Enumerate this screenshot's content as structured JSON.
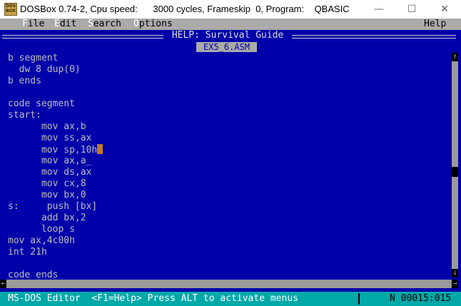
{
  "window": {
    "title": "DOSBox 0.74-2, Cpu speed:      3000 cycles, Frameskip  0, Program:    QBASIC",
    "icon_text": "DOS BOX",
    "minimize": "—",
    "maximize": "☐",
    "close": "✕"
  },
  "menu": {
    "file_hot": "F",
    "file_rest": "ile",
    "edit_hot": "E",
    "edit_rest": "dit",
    "search_hot": "S",
    "search_rest": "earch",
    "options_hot": "O",
    "options_rest": "ptions",
    "help": "Help"
  },
  "help_title": " HELP: Survival Guide ",
  "tab_label": "EX5_6.ASM",
  "code_lines": [
    "b segment",
    "  dw 8 dup(0)",
    "b ends",
    "",
    "code segment",
    "start:",
    "      mov ax,b",
    "      mov ss,ax",
    "      mov sp,10h",
    "      mov ax,a_",
    "      mov ds,ax",
    "      mov cx,8",
    "      mov bx,0",
    "s:     push [bx]",
    "      add bx,2",
    "      loop s",
    "mov ax,4c00h",
    "int 21h",
    "",
    "code ends"
  ],
  "scroll": {
    "up": "↑",
    "down": "↓",
    "left": "←",
    "right": "→"
  },
  "status": {
    "left": "MS-DOS Editor  <F1=Help> Press ALT to activate menus",
    "right": "N 00015:015"
  },
  "colors": {
    "dos_blue": "#0000aa",
    "menu_gray": "#aaaaaa",
    "status_cyan": "#00a8a8",
    "cursor": "#c07a28"
  }
}
